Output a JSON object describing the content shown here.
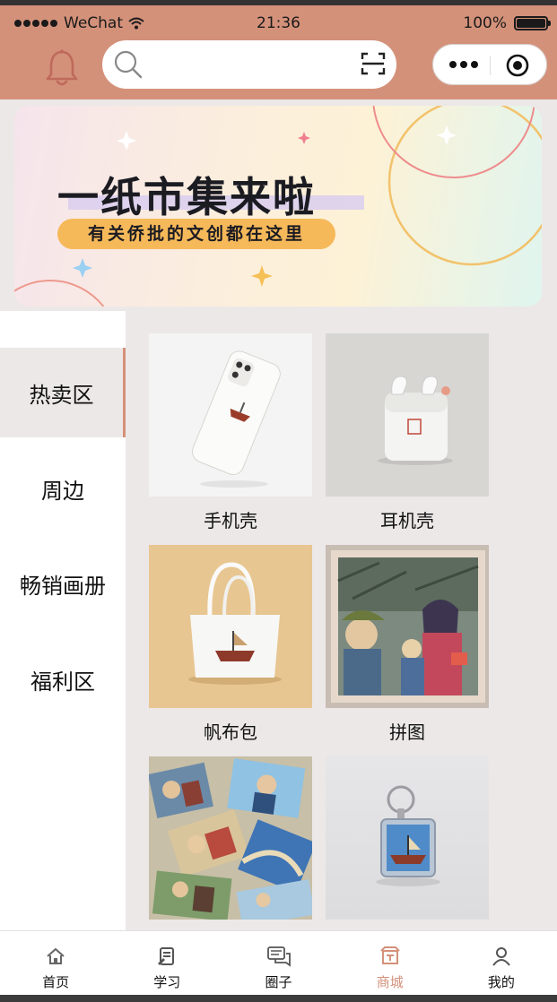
{
  "status_bar": {
    "carrier": "WeChat",
    "time": "21:36",
    "battery": "100%"
  },
  "search": {
    "placeholder": ""
  },
  "banner": {
    "title": "一纸市集来啦",
    "subtitle": "有关侨批的文创都在这里"
  },
  "sidebar": {
    "items": [
      {
        "label": "热卖区",
        "active": true
      },
      {
        "label": "周边",
        "active": false
      },
      {
        "label": "畅销画册",
        "active": false
      },
      {
        "label": "福利区",
        "active": false
      }
    ]
  },
  "products": [
    {
      "name": "手机壳"
    },
    {
      "name": "耳机壳"
    },
    {
      "name": "帆布包"
    },
    {
      "name": "拼图"
    },
    {
      "name": ""
    },
    {
      "name": ""
    }
  ],
  "tabbar": {
    "items": [
      {
        "label": "首页",
        "icon": "home-icon"
      },
      {
        "label": "学习",
        "icon": "study-icon"
      },
      {
        "label": "圈子",
        "icon": "chat-icon"
      },
      {
        "label": "商城",
        "icon": "shop-icon",
        "active": true
      },
      {
        "label": "我的",
        "icon": "user-icon"
      }
    ]
  },
  "colors": {
    "accent": "#d4917a",
    "background": "#ece8e8"
  }
}
